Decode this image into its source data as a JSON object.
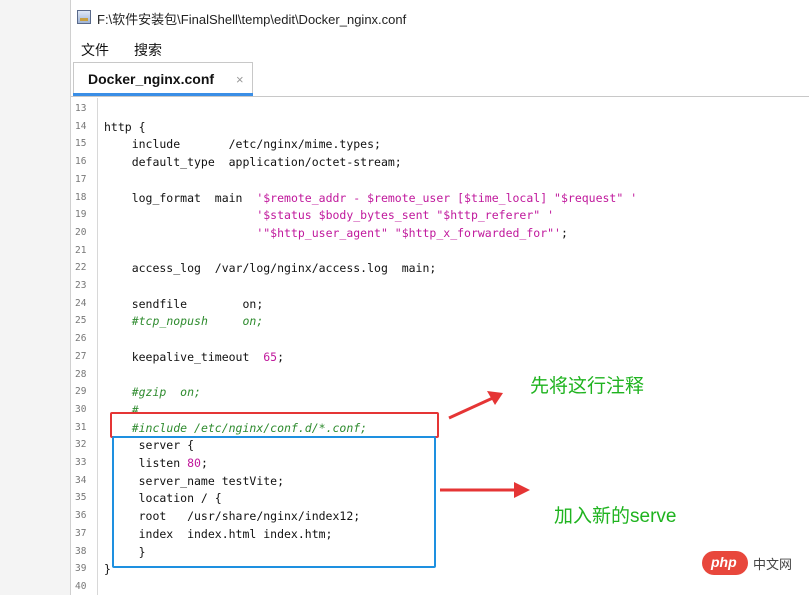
{
  "window": {
    "title": "F:\\软件安装包\\FinalShell\\temp\\edit\\Docker_nginx.conf",
    "app_icon": "finalshell-app-icon"
  },
  "menu": [
    "文件",
    "搜索"
  ],
  "tab": {
    "label": "Docker_nginx.conf",
    "close": "×"
  },
  "lines": [
    {
      "n": "13",
      "segs": []
    },
    {
      "n": "14",
      "segs": [
        {
          "t": "http {",
          "c": ""
        }
      ]
    },
    {
      "n": "15",
      "segs": [
        {
          "t": "    include       /etc/nginx/mime.types;",
          "c": ""
        }
      ]
    },
    {
      "n": "16",
      "segs": [
        {
          "t": "    default_type  application/octet-stream;",
          "c": ""
        }
      ]
    },
    {
      "n": "17",
      "segs": []
    },
    {
      "n": "18",
      "segs": [
        {
          "t": "    log_format  main  ",
          "c": ""
        },
        {
          "t": "'$remote_addr - $remote_user [$time_local] \"$request\" '",
          "c": "str"
        }
      ]
    },
    {
      "n": "19",
      "segs": [
        {
          "t": "                      ",
          "c": ""
        },
        {
          "t": "'$status $body_bytes_sent \"$http_referer\" '",
          "c": "str"
        }
      ]
    },
    {
      "n": "20",
      "segs": [
        {
          "t": "                      ",
          "c": ""
        },
        {
          "t": "'\"$http_user_agent\" \"$http_x_forwarded_for\"'",
          "c": "str"
        },
        {
          "t": ";",
          "c": ""
        }
      ]
    },
    {
      "n": "21",
      "segs": []
    },
    {
      "n": "22",
      "segs": [
        {
          "t": "    access_log  /var/log/nginx/access.log  main;",
          "c": ""
        }
      ]
    },
    {
      "n": "23",
      "segs": []
    },
    {
      "n": "24",
      "segs": [
        {
          "t": "    sendfile        on;",
          "c": ""
        }
      ]
    },
    {
      "n": "25",
      "segs": [
        {
          "t": "    ",
          "c": ""
        },
        {
          "t": "#tcp_nopush     on;",
          "c": "cmt"
        }
      ]
    },
    {
      "n": "26",
      "segs": []
    },
    {
      "n": "27",
      "segs": [
        {
          "t": "    keepalive_timeout  ",
          "c": ""
        },
        {
          "t": "65",
          "c": "num"
        },
        {
          "t": ";",
          "c": ""
        }
      ]
    },
    {
      "n": "28",
      "segs": []
    },
    {
      "n": "29",
      "segs": [
        {
          "t": "    ",
          "c": ""
        },
        {
          "t": "#gzip  on;",
          "c": "cmt"
        }
      ]
    },
    {
      "n": "30",
      "segs": [
        {
          "t": "    ",
          "c": ""
        },
        {
          "t": "#",
          "c": "cmt"
        }
      ]
    },
    {
      "n": "31",
      "segs": [
        {
          "t": "    ",
          "c": ""
        },
        {
          "t": "#include /etc/nginx/conf.d/*.conf;",
          "c": "cmt"
        }
      ]
    },
    {
      "n": "32",
      "segs": [
        {
          "t": "     server {",
          "c": ""
        }
      ]
    },
    {
      "n": "33",
      "segs": [
        {
          "t": "     listen ",
          "c": ""
        },
        {
          "t": "80",
          "c": "num"
        },
        {
          "t": ";",
          "c": ""
        }
      ]
    },
    {
      "n": "34",
      "segs": [
        {
          "t": "     server_name testVite;",
          "c": ""
        }
      ]
    },
    {
      "n": "35",
      "segs": [
        {
          "t": "     location / {",
          "c": ""
        }
      ]
    },
    {
      "n": "36",
      "segs": [
        {
          "t": "     root   /usr/share/nginx/index12;",
          "c": ""
        }
      ]
    },
    {
      "n": "37",
      "segs": [
        {
          "t": "     index  index.html index.htm;",
          "c": ""
        }
      ]
    },
    {
      "n": "38",
      "segs": [
        {
          "t": "     }",
          "c": ""
        }
      ]
    },
    {
      "n": "39",
      "segs": [
        {
          "t": "}",
          "c": ""
        }
      ]
    },
    {
      "n": "40",
      "segs": []
    }
  ],
  "annotations": {
    "comment_note": "先将这行注释",
    "add_note": "加入新的serve"
  },
  "watermark": {
    "badge": "php",
    "text": "中文网"
  },
  "colors": {
    "string": "#c0189c",
    "comment": "#2e8b2e",
    "red_box": "#e53535",
    "blue_box": "#1e90e0",
    "annotation": "#1fb31f",
    "tab_accent": "#3a8ee6"
  }
}
